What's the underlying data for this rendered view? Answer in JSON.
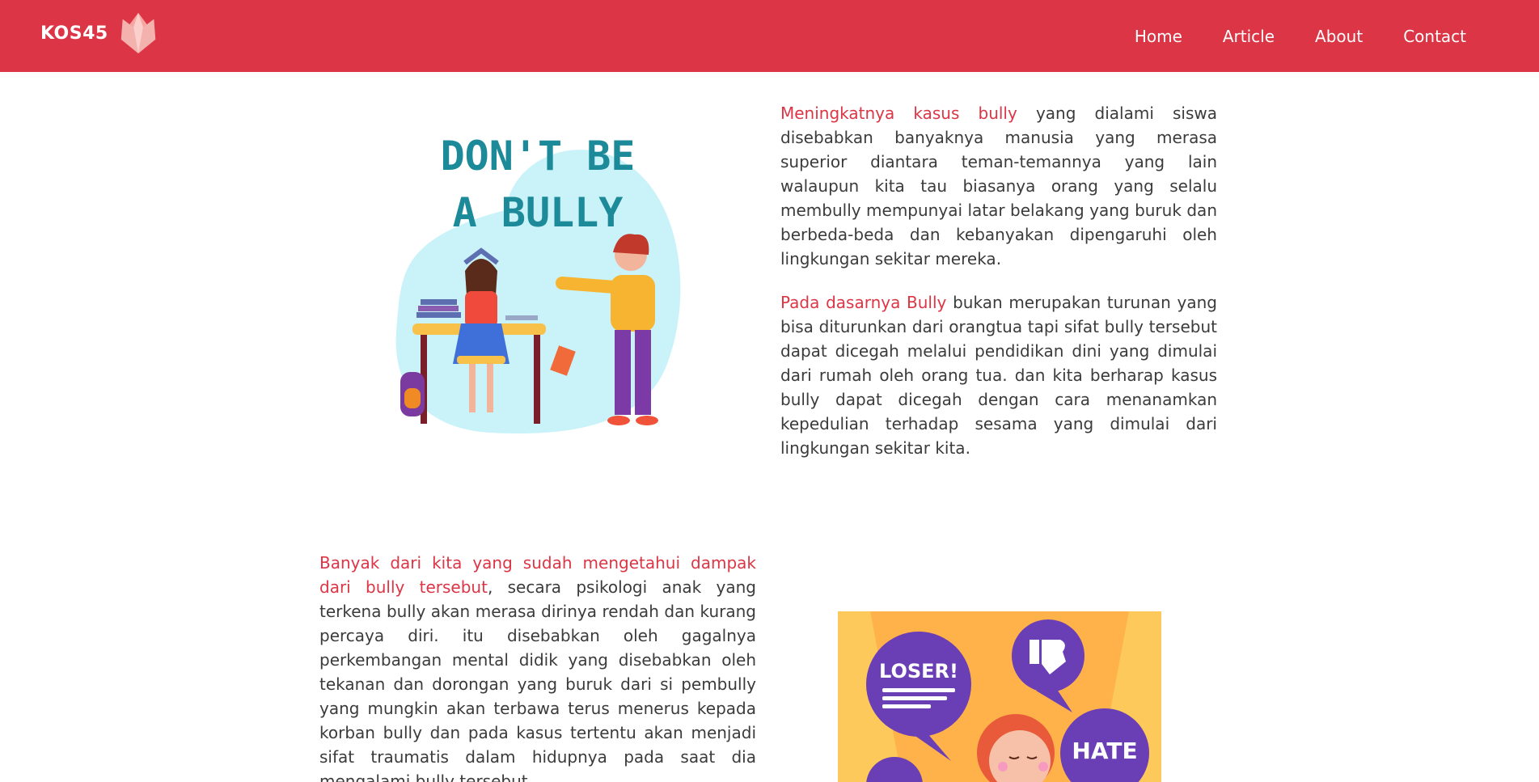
{
  "navbar": {
    "brand": "KOS45",
    "links": [
      "Home",
      "Article",
      "About",
      "Contact"
    ]
  },
  "sections": [
    {
      "highlight": "Meningkatnya kasus bully",
      "text": " yang dialami siswa disebabkan banyaknya manusia yang merasa superior diantara teman-temannya yang lain walaupun kita tau biasanya orang yang selalu membully mempunyai latar belakang yang buruk dan berbeda-beda dan kebanyakan dipengaruhi oleh lingkungan sekitar mereka."
    },
    {
      "highlight": "Pada dasarnya Bully",
      "text": " bukan merupakan turunan yang bisa diturunkan dari orangtua tapi sifat bully tersebut dapat dicegah melalui pendidikan dini yang dimulai dari rumah oleh orang tua. dan kita berharap kasus bully dapat dicegah dengan cara menanamkan kepedulian terhadap sesama yang dimulai dari lingkungan sekitar kita."
    },
    {
      "highlight": "Banyak dari kita yang sudah mengetahui dampak dari bully tersebut",
      "text": ", secara psikologi anak yang terkena bully akan merasa dirinya rendah dan kurang percaya diri. itu disebabkan oleh gagalnya perkembangan mental didik yang disebabkan oleh tekanan dan dorongan yang buruk dari si pembully yang mungkin akan terbawa terus menerus kepada korban bully dan pada kasus tertentu akan menjadi sifat traumatis dalam hidupnya pada saat dia mengalami bully tersebut."
    }
  ],
  "illustrations": {
    "first": {
      "line1": "DON'T BE",
      "line2": "A BULLY"
    },
    "second": {
      "bubble1": "LOSER!",
      "bubble2": "HATE"
    }
  },
  "colors": {
    "accent": "#dc3545",
    "bubble": "#6a3fb5",
    "sky": "#c9f3f8"
  }
}
